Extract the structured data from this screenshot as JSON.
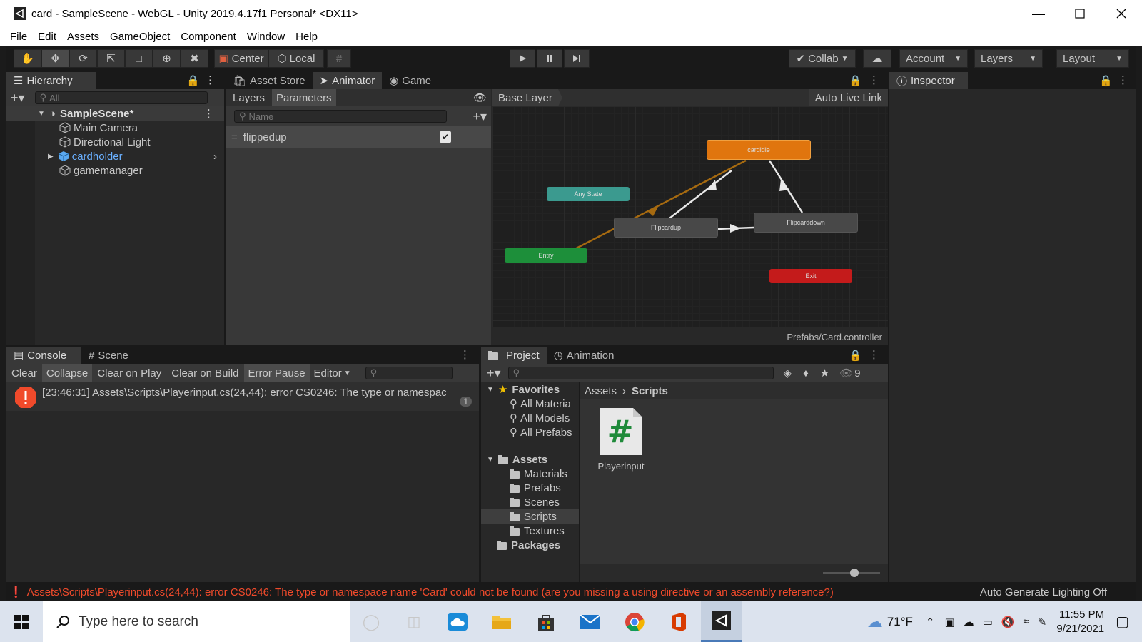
{
  "window": {
    "title": "card - SampleScene - WebGL - Unity 2019.4.17f1 Personal* <DX11>"
  },
  "menu": [
    "File",
    "Edit",
    "Assets",
    "GameObject",
    "Component",
    "Window",
    "Help"
  ],
  "toolbar": {
    "center_label": "Center",
    "local_label": "Local",
    "collab_label": "Collab",
    "account_label": "Account",
    "layers_label": "Layers",
    "layout_label": "Layout"
  },
  "hierarchy": {
    "tab": "Hierarchy",
    "search_placeholder": "All",
    "scene": "SampleScene*",
    "items": [
      "Main Camera",
      "Directional Light",
      "cardholder",
      "gamemanager"
    ]
  },
  "animator": {
    "tabs": [
      "Asset Store",
      "Animator",
      "Game"
    ],
    "subtabs": [
      "Layers",
      "Parameters"
    ],
    "name_placeholder": "Name",
    "param": {
      "name": "flippedup",
      "checked": true
    },
    "base_layer": "Base Layer",
    "auto_live_link": "Auto Live Link",
    "states": {
      "cardidle": "cardidle",
      "any": "Any State",
      "flipup": "Flipcardup",
      "flipdown": "Flipcarddown",
      "entry": "Entry",
      "exit": "Exit"
    },
    "footer": "Prefabs/Card.controller"
  },
  "inspector": {
    "tab": "Inspector"
  },
  "console": {
    "tabs": [
      "Console",
      "Scene"
    ],
    "buttons": [
      "Clear",
      "Collapse",
      "Clear on Play",
      "Clear on Build",
      "Error Pause",
      "Editor"
    ],
    "entry": "[23:46:31] Assets\\Scripts\\Playerinput.cs(24,44): error CS0246: The type or namespac",
    "count": "1"
  },
  "project": {
    "tabs": [
      "Project",
      "Animation"
    ],
    "hidden_count": "9",
    "favorites": "Favorites",
    "fav_items": [
      "All Materia",
      "All Models",
      "All Prefabs"
    ],
    "assets": "Assets",
    "folders": [
      "Materials",
      "Prefabs",
      "Scenes",
      "Scripts",
      "Textures"
    ],
    "packages": "Packages",
    "breadcrumb": [
      "Assets",
      "Scripts"
    ],
    "file_name": "Playerinput",
    "slider_level": 0.55
  },
  "statusbar": {
    "error": "Assets\\Scripts\\Playerinput.cs(24,44): error CS0246: The type or namespace name 'Card' could not be found (are you missing a using directive or an assembly reference?)",
    "lighting": "Auto Generate Lighting Off"
  },
  "taskbar": {
    "search_placeholder": "Type here to search",
    "temperature": "71°F",
    "time": "11:55 PM",
    "date": "9/21/2021"
  },
  "colors": {
    "cardidle": "#e0750e",
    "anystate": "#3b9a8f",
    "entry": "#1d8f3a",
    "exit": "#c41b1b",
    "error": "#f04a2b",
    "selected_blue": "#6ab0ff"
  }
}
